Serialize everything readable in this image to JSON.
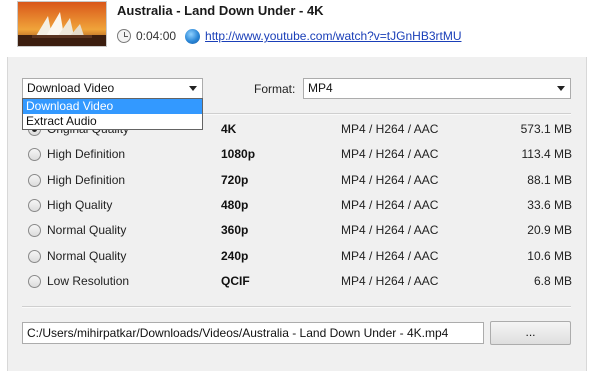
{
  "video": {
    "title": "Australia - Land Down Under - 4K",
    "duration": "0:04:00",
    "url": "http://www.youtube.com/watch?v=tJGnHB3rtMU"
  },
  "icons": {
    "clock": "clock-icon",
    "globe": "globe-icon",
    "dropdown_arrow": "chevron-down-icon"
  },
  "download_type": {
    "selected": "Download Video",
    "options": [
      "Download Video",
      "Extract Audio"
    ]
  },
  "format": {
    "label": "Format:",
    "selected": "MP4"
  },
  "qualities": [
    {
      "name": "Original Quality",
      "resolution": "4K",
      "format": "MP4 / H264 / AAC",
      "size": "573.1 MB",
      "checked": true
    },
    {
      "name": "High Definition",
      "resolution": "1080p",
      "format": "MP4 / H264 / AAC",
      "size": "113.4 MB",
      "checked": false
    },
    {
      "name": "High Definition",
      "resolution": "720p",
      "format": "MP4 / H264 / AAC",
      "size": "88.1 MB",
      "checked": false
    },
    {
      "name": "High Quality",
      "resolution": "480p",
      "format": "MP4 / H264 / AAC",
      "size": "33.6 MB",
      "checked": false
    },
    {
      "name": "Normal Quality",
      "resolution": "360p",
      "format": "MP4 / H264 / AAC",
      "size": "20.9 MB",
      "checked": false
    },
    {
      "name": "Normal Quality",
      "resolution": "240p",
      "format": "MP4 / H264 / AAC",
      "size": "10.6 MB",
      "checked": false
    },
    {
      "name": "Low Resolution",
      "resolution": "QCIF",
      "format": "MP4 / H264 / AAC",
      "size": "6.8 MB",
      "checked": false
    }
  ],
  "save": {
    "path": "C:/Users/mihirpatkar/Downloads/Videos/Australia - Land Down Under - 4K.mp4",
    "browse_label": "..."
  },
  "colors": {
    "link": "#1a3fb8",
    "selection": "#3399ff",
    "panel": "#f0f0f0"
  }
}
